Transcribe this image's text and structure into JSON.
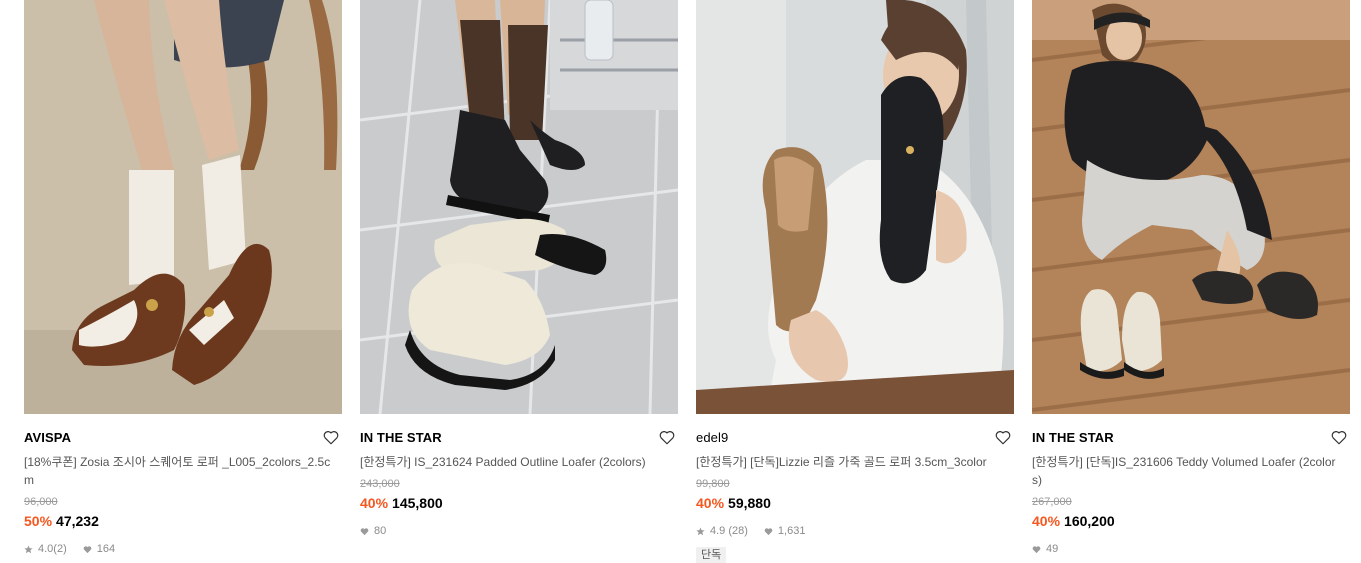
{
  "products": [
    {
      "brand": "AVISPA",
      "title": "[18%쿠폰] Zosia 조시아 스퀘어토 로퍼 _L005_2colors_2.5cm",
      "original_price": "96,000",
      "discount": "50%",
      "price": "47,232",
      "rating": "4.0",
      "reviews": "(2)",
      "likes": "164",
      "badge": ""
    },
    {
      "brand": "IN THE STAR",
      "title": "[한정특가] IS_231624 Padded Outline Loafer (2colors)",
      "original_price": "243,000",
      "discount": "40%",
      "price": "145,800",
      "rating": "",
      "reviews": "",
      "likes": "80",
      "badge": ""
    },
    {
      "brand": "edel9",
      "title": "[한정특가] [단독]Lizzie 리즐 가죽 골드 로퍼 3.5cm_3color",
      "original_price": "99,800",
      "discount": "40%",
      "price": "59,880",
      "rating": "4.9",
      "reviews": "(28)",
      "likes": "1,631",
      "badge": "단독"
    },
    {
      "brand": "IN THE STAR",
      "title": "[한정특가] [단독]IS_231606 Teddy Volumed Loafer (2colors)",
      "original_price": "267,000",
      "discount": "40%",
      "price": "160,200",
      "rating": "",
      "reviews": "",
      "likes": "49",
      "badge": ""
    }
  ],
  "colors": {
    "discount": "#f4571f",
    "muted": "#8a8a8a"
  },
  "icons": {
    "wishlist": "heart-outline-icon",
    "rating": "star-icon",
    "likes": "heart-filled-icon"
  }
}
